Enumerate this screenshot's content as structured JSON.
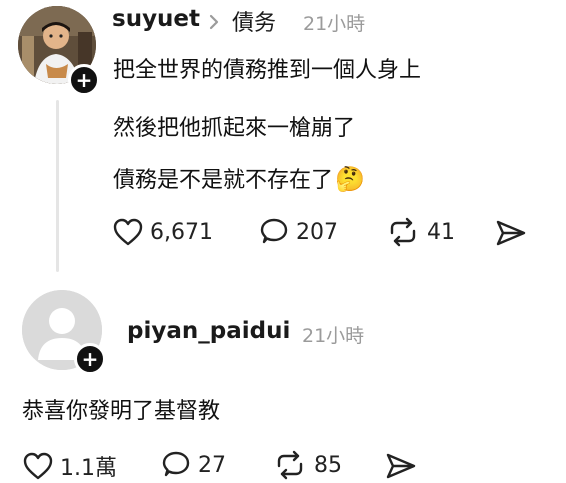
{
  "post1": {
    "username": "suyuet",
    "topic": "債务",
    "time": "21小時",
    "lines": [
      "把全世界的債務推到一個人身上",
      "然後把他抓起來一槍崩了",
      "債務是不是就不存在了"
    ],
    "emoji": "🤔",
    "likes": "6,671",
    "replies": "207",
    "reposts": "41"
  },
  "post2": {
    "username": "piyan_paidui",
    "time": "21小時",
    "text": "恭喜你發明了基督教",
    "likes": "1.1萬",
    "replies": "27",
    "reposts": "85"
  },
  "icons": [
    "plus-icon",
    "chevron-right-icon",
    "heart-icon",
    "comment-icon",
    "repost-icon",
    "share-icon",
    "default-avatar-icon"
  ],
  "colors": {
    "text": "#1a1a1a",
    "muted": "#9b9b9b",
    "thread": "#e5e5e5",
    "avatar_bg": "#dadada"
  }
}
